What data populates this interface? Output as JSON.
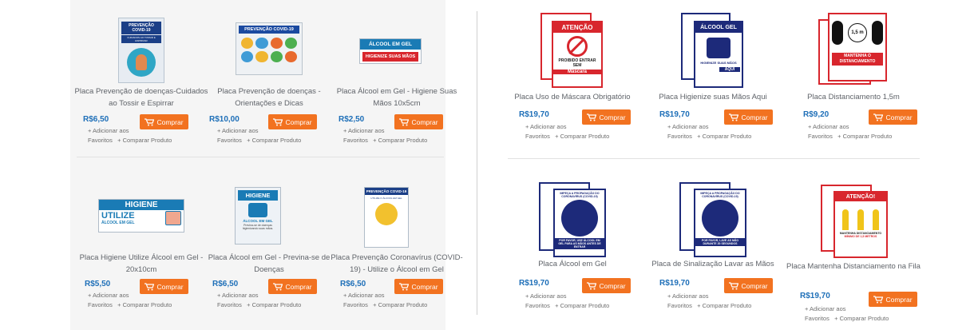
{
  "buy_label": "Comprar",
  "fav_a": "+ Adicionar aos",
  "fav_b": "Favoritos",
  "compare": "+ Comparar Produto",
  "colors": {
    "accent": "#f27220",
    "price": "#1e6fb8",
    "text": "#5f6369"
  },
  "products": [
    {
      "name": "Placa Prevenção de doenças-Cuidados ao Tossir e Espirrar",
      "price": "R$6,50",
      "image": {
        "heading": "PREVENÇÃO COVID-19",
        "sub": "CUIDADOS AO TOSSIR E ESPIRRAR"
      }
    },
    {
      "name": "Placa Prevenção de doenças - Orientações e Dicas",
      "price": "R$10,00",
      "image": {
        "heading": "PREVENÇÃO COVID-19"
      }
    },
    {
      "name": "Placa Álcool em Gel - Higiene Suas Mãos 10x5cm",
      "price": "R$2,50",
      "image": {
        "heading": "ÁLCOOL EM GEL",
        "sub": "HIGIENIZE SUAS MÃOS"
      }
    },
    {
      "name": "Placa Uso de Máscara Obrigatório",
      "price": "R$19,70",
      "image": {
        "heading": "ATENÇÃO",
        "sub": "PROIBIDO ENTRAR SEM",
        "sub2": "Máscara"
      }
    },
    {
      "name": "Placa Higienize suas Mãos Aqui",
      "price": "R$19,70",
      "image": {
        "heading": "ÁLCOOL GEL",
        "sub": "HIGIENIZE SUAS MÃOS",
        "sub2": "AQUI"
      }
    },
    {
      "name": "Placa Distanciamento 1,5m",
      "price": "R$9,20",
      "image": {
        "heading": "1,5 m",
        "sub": "MANTENHA O DISTANCIAMENTO"
      }
    },
    {
      "name": "Placa Higiene Utilize Álcool em Gel - 20x10cm",
      "price": "R$5,50",
      "image": {
        "heading": "HIGIENE",
        "sub": "UTILIZE",
        "sub2": "ÁLCOOL EM GEL"
      }
    },
    {
      "name": "Placa Álcool em Gel - Previna-se de Doenças",
      "price": "R$6,50",
      "image": {
        "heading": "HIGIENE",
        "sub": "ÁLCOOL EM GEL",
        "sub2": "Previna-se de doenças higienizando suas mãos."
      }
    },
    {
      "name": "Placa Prevenção Coronavírus (COVID-19) - Utilize o Álcool em Gel",
      "price": "R$6,50",
      "image": {
        "heading": "PREVENÇÃO COVID-19",
        "sub": "UTILIZE O ÁLCOOL EM GEL"
      }
    },
    {
      "name": "Placa Álcool em Gel",
      "price": "R$19,70",
      "image": {
        "heading": "IMPEÇA A PROPAGAÇÃO DO CORONAVÍRUS (COVID-19)",
        "sub": "POR FAVOR, USE ÁLCOOL EM GEL PARA AS MÃOS ANTES DE ENTRAR"
      }
    },
    {
      "name": "Placa de Sinalização Lavar as Mãos",
      "price": "R$19,70",
      "image": {
        "heading": "IMPEÇA A PROPAGAÇÃO DO CORONAVÍRUS (COVID-19)",
        "sub": "POR FAVOR, LAVE AS MÃO DURANTE 20 SEGUNDOS"
      }
    },
    {
      "name": "Placa Mantenha Distanciamento na Fila",
      "price": "R$19,70",
      "image": {
        "heading": "ATENÇÃO!",
        "sub": "MANTENHA DISTANCIAMENTO",
        "sub2": "MÍNIMO DE 1,5 METROS"
      }
    }
  ]
}
